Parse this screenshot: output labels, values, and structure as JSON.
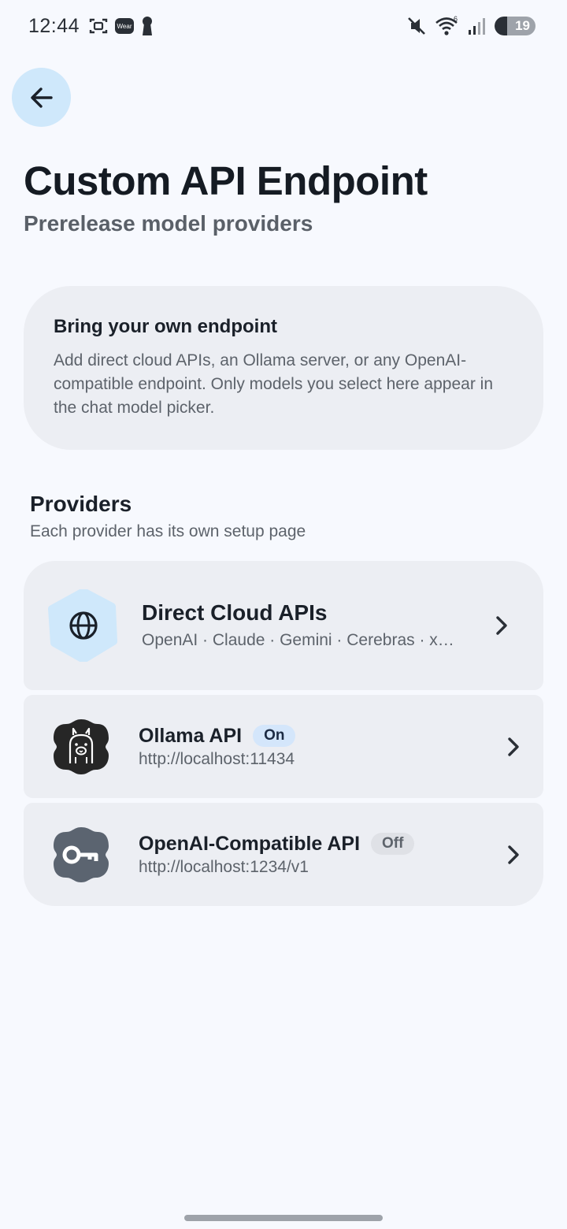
{
  "status_bar": {
    "time": "12:44",
    "wear_label": "Wear",
    "battery_level": "19",
    "icons": [
      "screenshot-icon",
      "wear-badge",
      "keyhole-icon",
      "mute-icon",
      "wifi-icon",
      "signal-icon",
      "battery-charging-icon"
    ]
  },
  "header": {
    "back_icon": "arrow-left-icon",
    "title": "Custom API Endpoint",
    "subtitle": "Prerelease model providers"
  },
  "info_card": {
    "title": "Bring your own endpoint",
    "body": "Add direct cloud APIs, an Ollama server, or any OpenAI-compatible endpoint. Only models you select here appear in the chat model picker."
  },
  "providers_section": {
    "title": "Providers",
    "subtitle": "Each provider has its own setup page",
    "items": [
      {
        "name": "Direct Cloud APIs",
        "detail": "OpenAI · Claude · Gemini · Cerebras · x…",
        "icon": "globe-icon",
        "icon_bg": "#cfe8fb"
      },
      {
        "name": "Ollama API",
        "status": "On",
        "detail": "http://localhost:11434",
        "icon": "llama-icon",
        "icon_bg": "#262626"
      },
      {
        "name": "OpenAI-Compatible API",
        "status": "Off",
        "detail": "http://localhost:1234/v1",
        "icon": "key-icon",
        "icon_bg": "#5b6470"
      }
    ]
  },
  "colors": {
    "background": "#f7f9fe",
    "card": "#eceef3",
    "accent": "#cfe8fb",
    "on_pill": "#d4e6fb",
    "off_pill": "#dfe1e6"
  }
}
